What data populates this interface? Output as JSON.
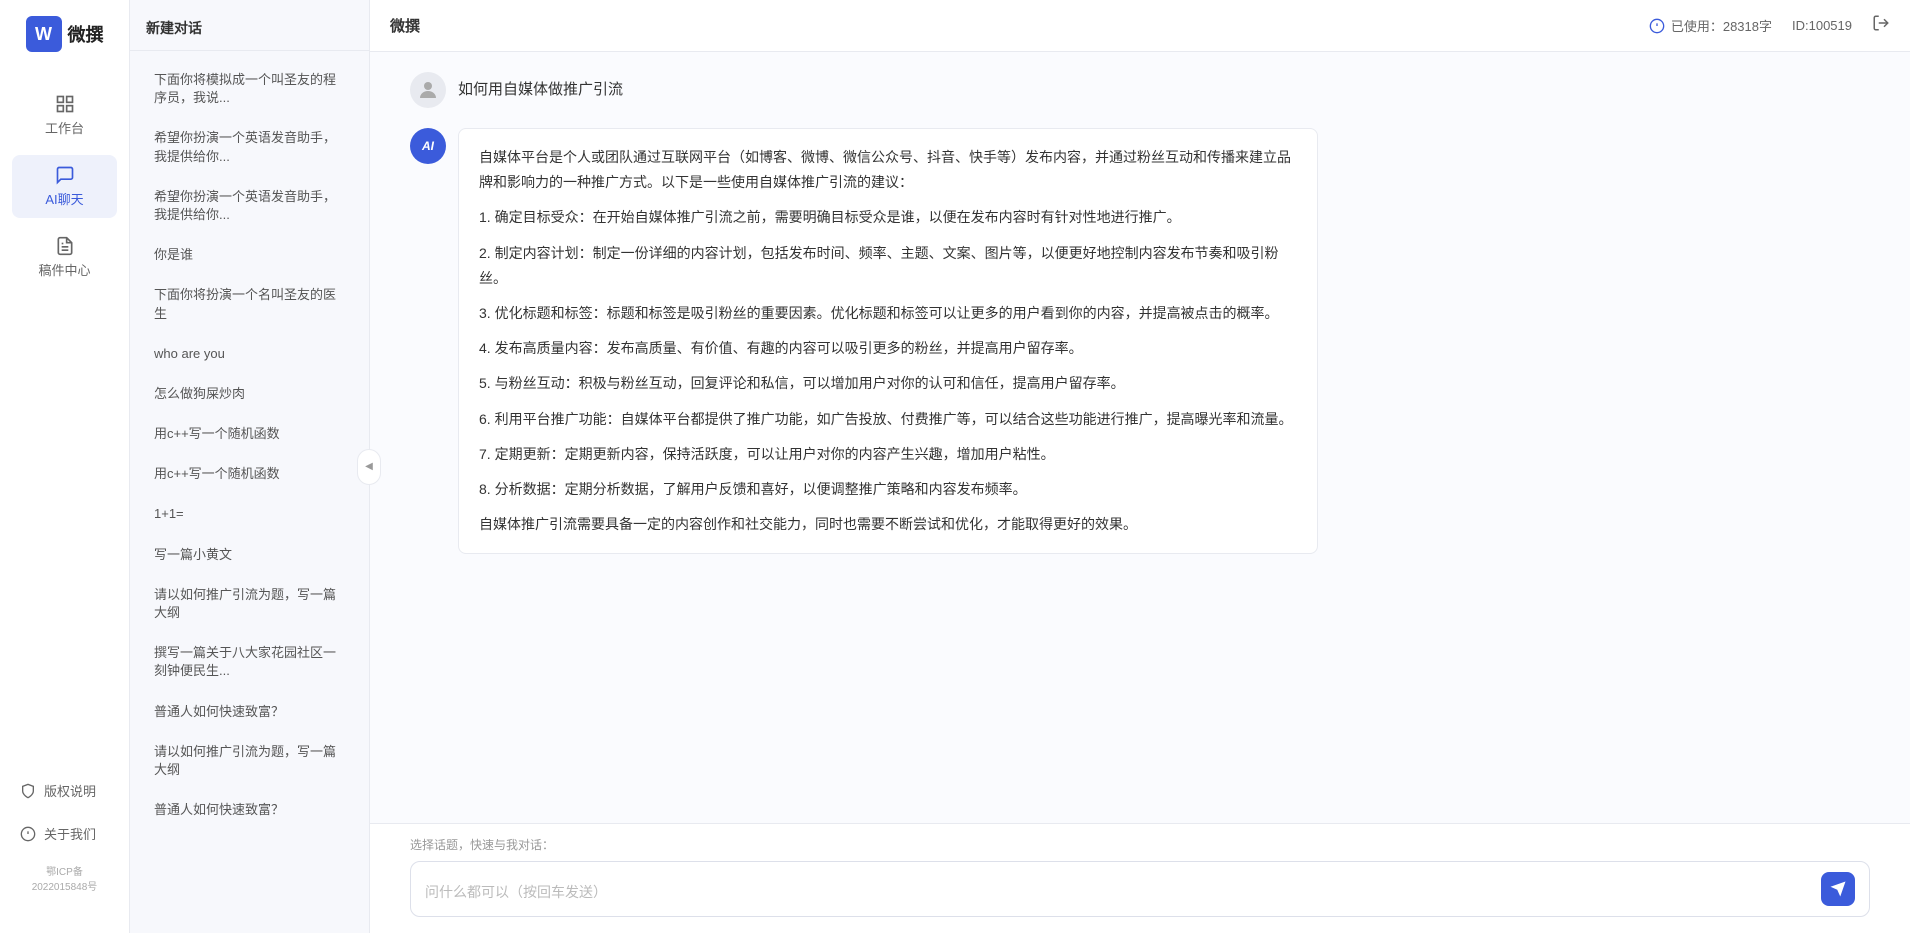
{
  "brand": {
    "name": "微撰",
    "logo_letter": "W"
  },
  "nav": {
    "items": [
      {
        "id": "workbench",
        "label": "工作台",
        "icon": "grid-icon",
        "active": false
      },
      {
        "id": "ai-chat",
        "label": "AI聊天",
        "icon": "chat-icon",
        "active": true
      },
      {
        "id": "drafts",
        "label": "稿件中心",
        "icon": "document-icon",
        "active": false
      }
    ],
    "bottom_items": [
      {
        "id": "copyright",
        "label": "版权说明",
        "icon": "info-icon"
      },
      {
        "id": "about",
        "label": "关于我们",
        "icon": "circle-info-icon"
      }
    ],
    "icp": "鄂ICP备2022015848号"
  },
  "history": {
    "new_chat_label": "新建对话",
    "items": [
      {
        "id": "h1",
        "text": "下面你将模拟成一个叫圣友的程序员，我说..."
      },
      {
        "id": "h2",
        "text": "希望你扮演一个英语发音助手，我提供给你..."
      },
      {
        "id": "h3",
        "text": "希望你扮演一个英语发音助手，我提供给你..."
      },
      {
        "id": "h4",
        "text": "你是谁"
      },
      {
        "id": "h5",
        "text": "下面你将扮演一个名叫圣友的医生"
      },
      {
        "id": "h6",
        "text": "who are you"
      },
      {
        "id": "h7",
        "text": "怎么做狗屎炒肉"
      },
      {
        "id": "h8",
        "text": "用c++写一个随机函数"
      },
      {
        "id": "h9",
        "text": "用c++写一个随机函数"
      },
      {
        "id": "h10",
        "text": "1+1="
      },
      {
        "id": "h11",
        "text": "写一篇小黄文"
      },
      {
        "id": "h12",
        "text": "请以如何推广引流为题，写一篇大纲"
      },
      {
        "id": "h13",
        "text": "撰写一篇关于八大家花园社区一刻钟便民生..."
      },
      {
        "id": "h14",
        "text": "普通人如何快速致富？"
      },
      {
        "id": "h15",
        "text": "请以如何推广引流为题，写一篇大纲"
      },
      {
        "id": "h16",
        "text": "普通人如何快速致富？"
      }
    ]
  },
  "topbar": {
    "title": "微撰",
    "usage_label": "已使用：28318字",
    "id_label": "ID:100519",
    "usage_icon": "info-circle-icon"
  },
  "chat": {
    "messages": [
      {
        "id": "m1",
        "role": "user",
        "text": "如何用自媒体做推广引流",
        "avatar_type": "user"
      },
      {
        "id": "m2",
        "role": "ai",
        "paragraphs": [
          "自媒体平台是个人或团队通过互联网平台（如博客、微博、微信公众号、抖音、快手等）发布内容，并通过粉丝互动和传播来建立品牌和影响力的一种推广方式。以下是一些使用自媒体推广引流的建议：",
          "1. 确定目标受众：在开始自媒体推广引流之前，需要明确目标受众是谁，以便在发布内容时有针对性地进行推广。",
          "2. 制定内容计划：制定一份详细的内容计划，包括发布时间、频率、主题、文案、图片等，以便更好地控制内容发布节奏和吸引粉丝。",
          "3. 优化标题和标签：标题和标签是吸引粉丝的重要因素。优化标题和标签可以让更多的用户看到你的内容，并提高被点击的概率。",
          "4. 发布高质量内容：发布高质量、有价值、有趣的内容可以吸引更多的粉丝，并提高用户留存率。",
          "5. 与粉丝互动：积极与粉丝互动，回复评论和私信，可以增加用户对你的认可和信任，提高用户留存率。",
          "6. 利用平台推广功能：自媒体平台都提供了推广功能，如广告投放、付费推广等，可以结合这些功能进行推广，提高曝光率和流量。",
          "7. 定期更新：定期更新内容，保持活跃度，可以让用户对你的内容产生兴趣，增加用户粘性。",
          "8. 分析数据：定期分析数据，了解用户反馈和喜好，以便调整推广策略和内容发布频率。",
          "自媒体推广引流需要具备一定的内容创作和社交能力，同时也需要不断尝试和优化，才能取得更好的效果。"
        ]
      }
    ]
  },
  "input": {
    "quick_topics_label": "选择话题，快速与我对话：",
    "placeholder": "问什么都可以（按回车发送）",
    "send_icon": "send-icon"
  }
}
